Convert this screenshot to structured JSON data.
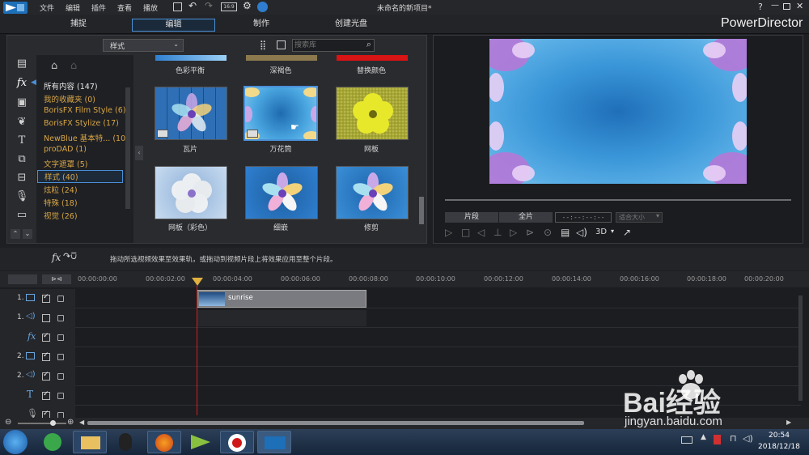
{
  "menu": {
    "items": [
      "文件",
      "编辑",
      "插件",
      "查看",
      "播放"
    ],
    "project_title": "未命名的新项目*",
    "help": "?"
  },
  "modes": {
    "tabs": [
      "捕捉",
      "编辑",
      "制作",
      "创建光盘"
    ],
    "active": "编辑",
    "brand": "PowerDirector"
  },
  "library": {
    "filter_value": "样式",
    "search_placeholder": "搜索库",
    "top_labels": [
      "色彩平衡",
      "深褐色",
      "替换颜色"
    ],
    "categories": [
      {
        "label": "所有内容 (147)"
      },
      {
        "label": "我的收藏夹  (0)"
      },
      {
        "label": "BorisFX Film Style  (6)"
      },
      {
        "label": "BorisFX Stylize  (17)"
      },
      {
        "label": "NewBlue 基本特...  (10)"
      },
      {
        "label": "proDAD  (1)"
      },
      {
        "label": "文字遮罩  (5)"
      },
      {
        "label": "样式  (40)"
      },
      {
        "label": "炫粒  (24)"
      },
      {
        "label": "特殊  (18)"
      },
      {
        "label": "视觉  (26)"
      }
    ],
    "selected_category": "样式  (40)",
    "effects": [
      {
        "label": "瓦片"
      },
      {
        "label": "万花筒"
      },
      {
        "label": "网板"
      },
      {
        "label": "网板（彩色）"
      },
      {
        "label": "细嵌"
      },
      {
        "label": "修剪"
      }
    ]
  },
  "preview": {
    "clip_tab": "片段",
    "movie_tab": "全片",
    "timecode": "--:--:--:--",
    "fit_label": "适合大小",
    "mode_3d": "3D"
  },
  "hint": {
    "fx_label": "fx",
    "text": "拖动所选视频效果至效果轨，或拖动到视频片段上将效果应用至整个片段。"
  },
  "timeline": {
    "ruler": [
      "00:00:00:00",
      "00:00:02:00",
      "00:00:04:00",
      "00:00:06:00",
      "00:00:08:00",
      "00:00:10:00",
      "00:00:12:00",
      "00:00:14:00",
      "00:00:16:00",
      "00:00:18:00",
      "00:00:20:00"
    ],
    "tracks": [
      {
        "label": "1.",
        "type": "video"
      },
      {
        "label": "1.",
        "type": "audio"
      },
      {
        "label": "fx",
        "type": "fx"
      },
      {
        "label": "2.",
        "type": "video"
      },
      {
        "label": "2.",
        "type": "audio"
      },
      {
        "label": "T",
        "type": "title"
      },
      {
        "label": "",
        "type": "voice"
      }
    ],
    "clip_name": "sunrise"
  },
  "taskbar": {
    "time": "20:54",
    "date": "2018/12/18"
  },
  "watermark": {
    "text": "Bai经验",
    "url": "jingyan.baidu.com"
  },
  "colors": {
    "accent": "#4a8fd6",
    "category_text": "#d8a645",
    "playhead": "#d02020"
  }
}
